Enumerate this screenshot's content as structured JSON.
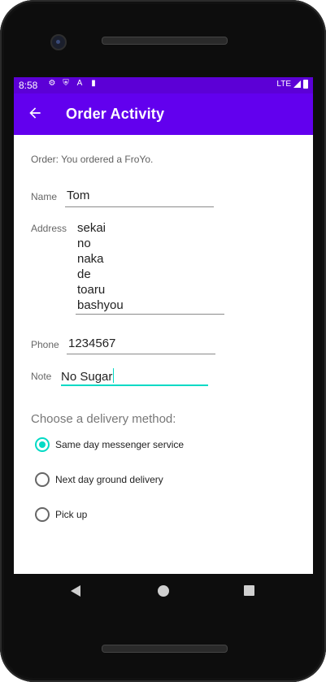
{
  "status_bar": {
    "time": "8:58",
    "network": "LTE",
    "icons": [
      "settings-icon",
      "shield-icon",
      "font-icon",
      "sd-card-icon"
    ]
  },
  "app_bar": {
    "title": "Order Activity",
    "back_icon": "arrow-back-icon",
    "color": "#6200ee"
  },
  "order": {
    "message": "Order: You ordered a FroYo."
  },
  "form": {
    "name_label": "Name",
    "name_value": "Tom",
    "address_label": "Address",
    "address_lines": [
      "sekai",
      "no",
      "naka",
      "de",
      "toaru",
      "bashyou"
    ],
    "phone_label": "Phone",
    "phone_value": "1234567",
    "note_label": "Note",
    "note_value": "No Sugar"
  },
  "delivery": {
    "title": "Choose a delivery method:",
    "options": [
      {
        "label": "Same day messenger service",
        "selected": true
      },
      {
        "label": "Next day ground delivery",
        "selected": false
      },
      {
        "label": "Pick up",
        "selected": false
      }
    ],
    "accent": "#03dac5"
  }
}
